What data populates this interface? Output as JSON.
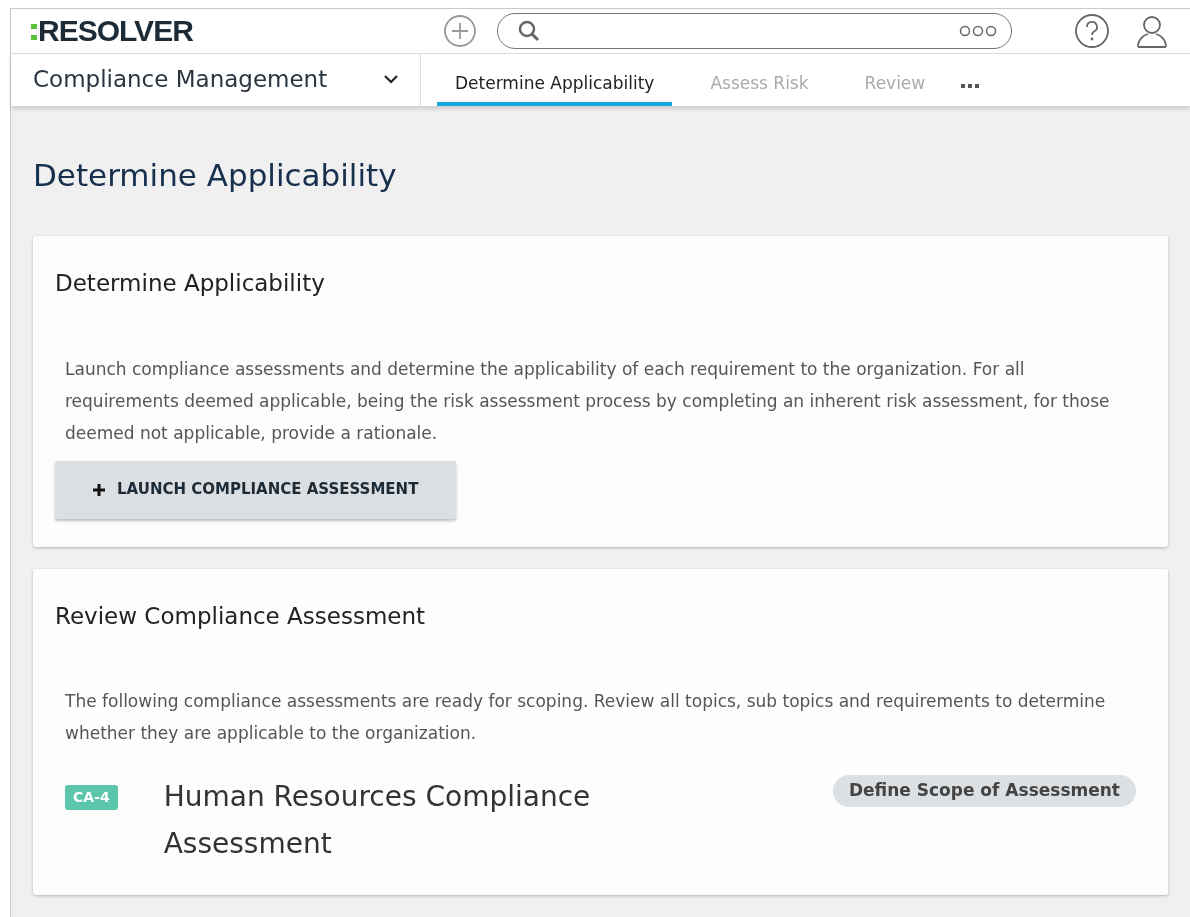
{
  "header": {
    "logo": "RESOLVER"
  },
  "nav": {
    "app_title": "Compliance Management",
    "tabs": [
      {
        "label": "Determine Applicability",
        "selected": true
      },
      {
        "label": "Assess Risk",
        "selected": false
      },
      {
        "label": "Review",
        "selected": false
      }
    ]
  },
  "page_title": "Determine Applicability",
  "cards": [
    {
      "title": "Determine Applicability",
      "description": "Launch compliance assessments and determine the applicability of each requirement to the organization. For all requirements deemed applicable, being the risk assessment process by completing an inherent risk assessment, for those deemed not applicable, provide a rationale.",
      "button": "LAUNCH COMPLIANCE ASSESSMENT"
    },
    {
      "title": "Review Compliance Assessment",
      "description": "The following compliance assessments are ready for scoping. Review all topics, sub topics and requirements to determine whether they are applicable to the organization.",
      "items": [
        {
          "id": "CA-4",
          "name": "Human Resources Compliance Assessment",
          "status": "Define Scope of Assessment",
          "color": "#5cc6ad"
        }
      ]
    }
  ]
}
